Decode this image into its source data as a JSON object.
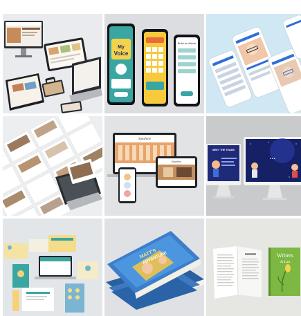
{
  "tiles": [
    {
      "id": "tile-1",
      "bg": "#e9ebee"
    },
    {
      "id": "tile-2",
      "bg": "#dcdde0",
      "app_logo_a": "My",
      "app_logo_b": "Voice",
      "app_subtitle": "Build an Article"
    },
    {
      "id": "tile-3",
      "bg": "#cfe8f4"
    },
    {
      "id": "tile-4",
      "bg": "#eceeef"
    },
    {
      "id": "tile-5",
      "bg": "#e2e3e5"
    },
    {
      "id": "tile-6",
      "bg": "#c9cacc",
      "heading": "MEET THE TEAMS"
    },
    {
      "id": "tile-7",
      "bg": "#e3e6e8"
    },
    {
      "id": "tile-8",
      "bg": "#dfe1e4"
    },
    {
      "id": "tile-9",
      "bg": "#e6e6e3",
      "book_title_a": "Writers",
      "book_title_b": "At Last"
    }
  ],
  "colors": {
    "accent_blue": "#2f6fd6",
    "navy": "#1c2a6b",
    "teal": "#2f8a8f",
    "green": "#7cb842"
  }
}
